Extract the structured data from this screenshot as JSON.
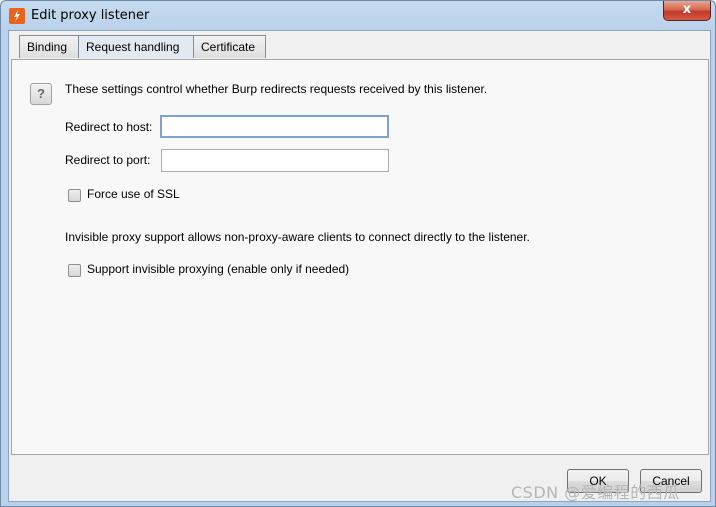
{
  "window": {
    "title": "Edit proxy listener",
    "close_label": "x"
  },
  "tabs": [
    {
      "label": "Binding",
      "active": false
    },
    {
      "label": "Request handling",
      "active": true
    },
    {
      "label": "Certificate",
      "active": false
    }
  ],
  "request_handling": {
    "help_label": "?",
    "description": "These settings control whether Burp redirects requests received by this listener.",
    "redirect_host_label": "Redirect to host:",
    "redirect_host_value": "",
    "redirect_port_label": "Redirect to port:",
    "redirect_port_value": "",
    "force_ssl_label": "Force use of SSL",
    "force_ssl_checked": false,
    "invisible_description": "Invisible proxy support allows non-proxy-aware clients to connect directly to the listener.",
    "invisible_label": "Support invisible proxying (enable only if needed)",
    "invisible_checked": false
  },
  "footer": {
    "ok_label": "OK",
    "cancel_label": "Cancel"
  },
  "watermark": "CSDN @爱编程的西瓜"
}
